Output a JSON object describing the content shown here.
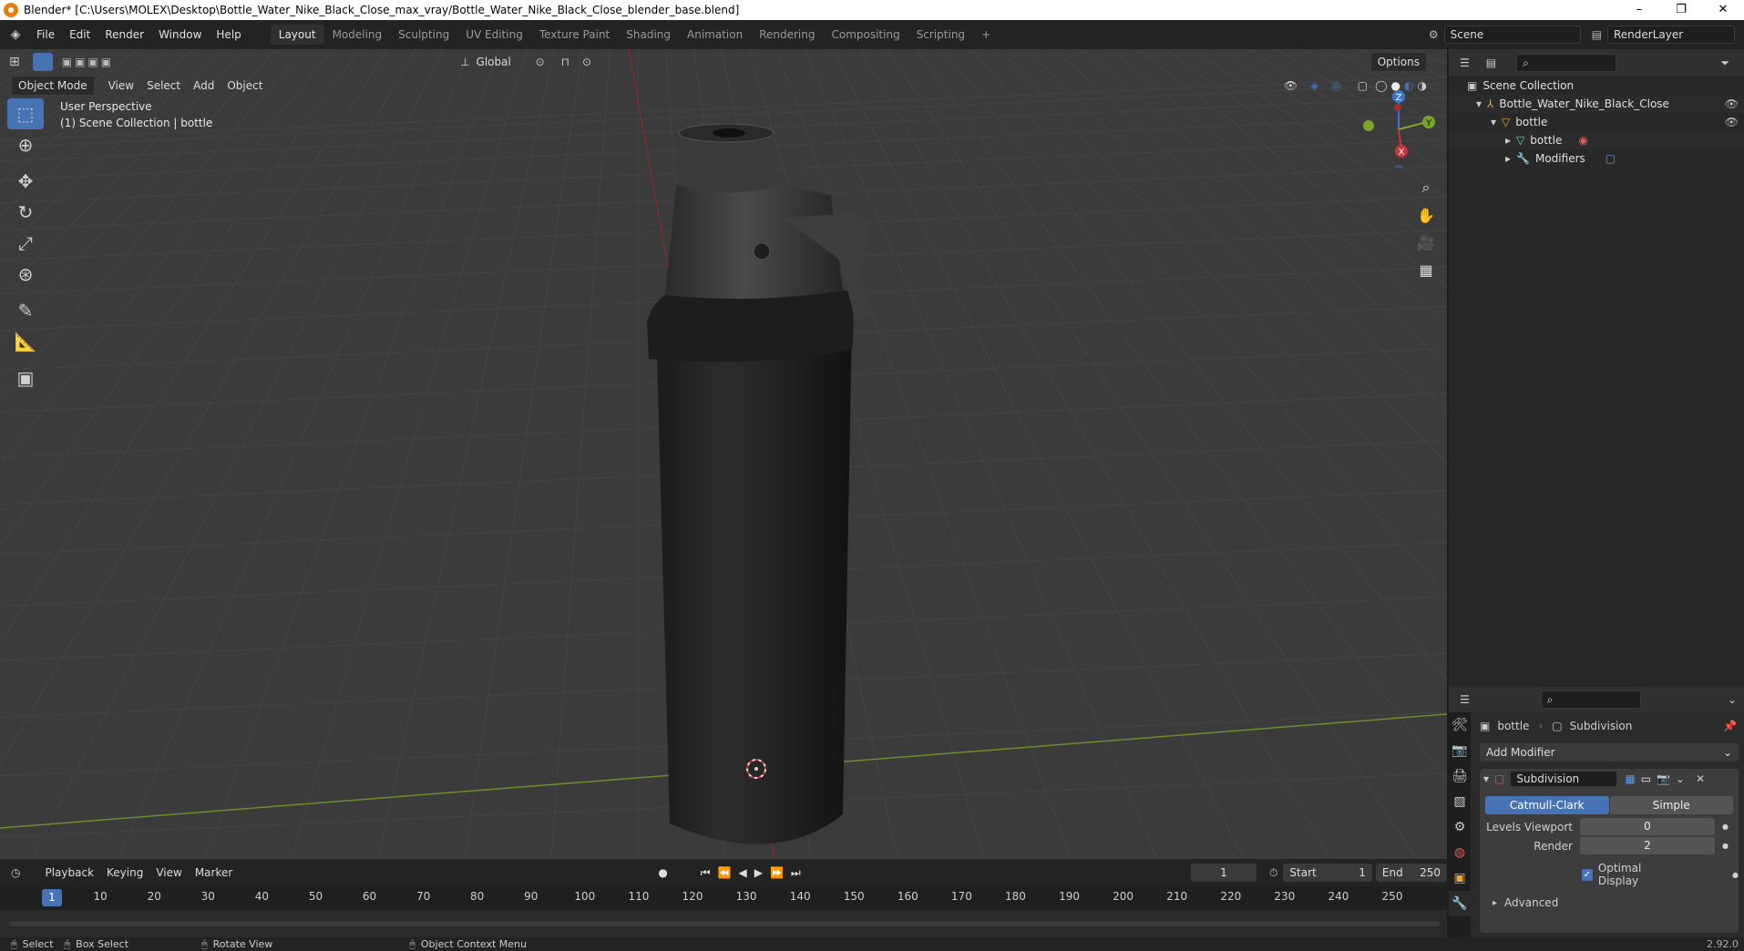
{
  "titlebar": {
    "title": "Blender* [C:\\Users\\MOLEX\\Desktop\\Bottle_Water_Nike_Black_Close_max_vray/Bottle_Water_Nike_Black_Close_blender_base.blend]",
    "minimize": "–",
    "maximize": "❐",
    "close": "✕"
  },
  "menu": [
    "File",
    "Edit",
    "Render",
    "Window",
    "Help"
  ],
  "workspaces": [
    "Layout",
    "Modeling",
    "Sculpting",
    "UV Editing",
    "Texture Paint",
    "Shading",
    "Animation",
    "Rendering",
    "Compositing",
    "Scripting"
  ],
  "workspace_add": "+",
  "active_workspace": "Layout",
  "scene": {
    "label": "Scene",
    "layer": "RenderLayer"
  },
  "viewport_header": {
    "mode": "Object Mode",
    "menus": [
      "View",
      "Select",
      "Add",
      "Object"
    ],
    "transform_orientation": "Global",
    "options": "Options"
  },
  "viewport": {
    "perspective": "User Perspective",
    "collection_info": "(1) Scene Collection | bottle",
    "gizmo": {
      "x": "X",
      "y": "Y",
      "z": "Z"
    }
  },
  "outliner": {
    "root": "Scene Collection",
    "items": [
      {
        "label": "Bottle_Water_Nike_Black_Close",
        "indent": 1
      },
      {
        "label": "bottle",
        "indent": 2
      },
      {
        "label": "bottle",
        "indent": 3
      },
      {
        "label": "Modifiers",
        "indent": 3
      }
    ]
  },
  "properties": {
    "object_name": "bottle",
    "modifier_name": "Subdivision",
    "add_modifier": "Add Modifier",
    "modifier_field": "Subdivision",
    "type_options": [
      "Catmull-Clark",
      "Simple"
    ],
    "levels_viewport_label": "Levels Viewport",
    "levels_viewport_value": "0",
    "render_label": "Render",
    "render_value": "2",
    "optimal_display": "Optimal Display",
    "advanced": "Advanced"
  },
  "timeline": {
    "menus": [
      "Playback",
      "Keying",
      "View",
      "Marker"
    ],
    "current_frame": "1",
    "start_label": "Start",
    "start_value": "1",
    "end_label": "End",
    "end_value": "250",
    "ticks": [
      "1",
      "10",
      "20",
      "30",
      "40",
      "50",
      "60",
      "70",
      "80",
      "90",
      "100",
      "110",
      "120",
      "130",
      "140",
      "150",
      "160",
      "170",
      "180",
      "190",
      "200",
      "210",
      "220",
      "230",
      "240",
      "250"
    ]
  },
  "statusbar": {
    "select": "Select",
    "box_select": "Box Select",
    "rotate_view": "Rotate View",
    "context_menu": "Object Context Menu",
    "version": "2.92.0"
  },
  "colors": {
    "accent": "#4772b3",
    "x_axis": "#c8353c",
    "y_axis": "#7ba42d",
    "z_axis": "#3d74c9"
  }
}
